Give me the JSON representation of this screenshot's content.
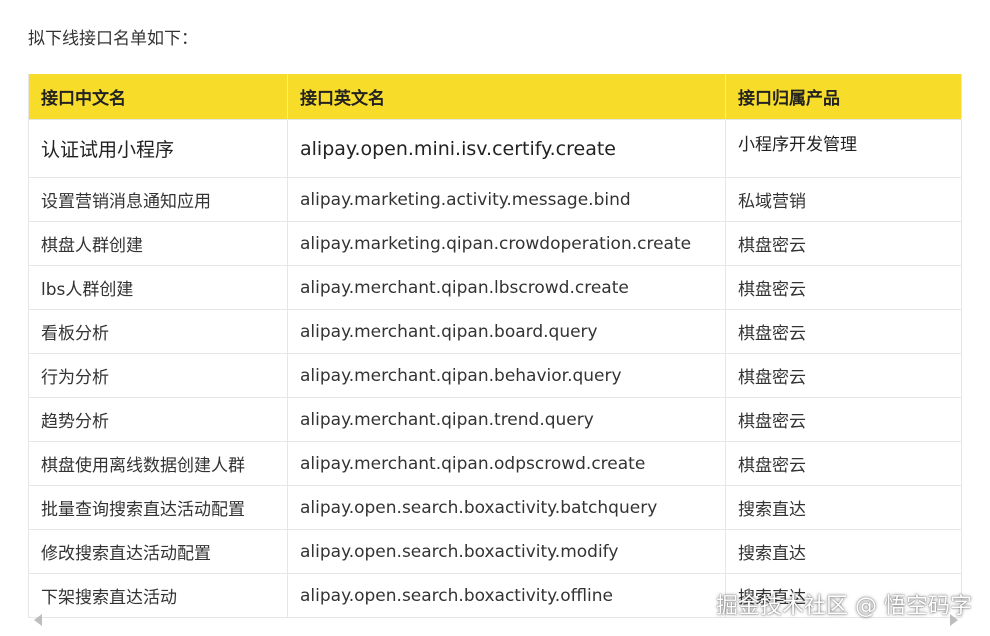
{
  "intro": "拟下线接口名单如下：",
  "table": {
    "headers": [
      "接口中文名",
      "接口英文名",
      "接口归属产品"
    ],
    "rows": [
      [
        "认证试用小程序",
        "alipay.open.mini.isv.certify.create",
        "小程序开发管理"
      ],
      [
        "设置营销消息通知应用",
        "alipay.marketing.activity.message.bind",
        "私域营销"
      ],
      [
        "棋盘人群创建",
        "alipay.marketing.qipan.crowdoperation.create",
        "棋盘密云"
      ],
      [
        "lbs人群创建",
        "alipay.merchant.qipan.lbscrowd.create",
        "棋盘密云"
      ],
      [
        "看板分析",
        "alipay.merchant.qipan.board.query",
        "棋盘密云"
      ],
      [
        "行为分析",
        "alipay.merchant.qipan.behavior.query",
        "棋盘密云"
      ],
      [
        "趋势分析",
        "alipay.merchant.qipan.trend.query",
        "棋盘密云"
      ],
      [
        "棋盘使用离线数据创建人群",
        "alipay.merchant.qipan.odpscrowd.create",
        "棋盘密云"
      ],
      [
        "批量查询搜索直达活动配置",
        "alipay.open.search.boxactivity.batchquery",
        "搜索直达"
      ],
      [
        "修改搜索直达活动配置",
        "alipay.open.search.boxactivity.modify",
        "搜索直达"
      ],
      [
        "下架搜索直达活动",
        "alipay.open.search.boxactivity.offline",
        "搜索直达"
      ]
    ]
  },
  "watermark": "掘金技术社区 @ 悟空码字",
  "colors": {
    "header_bg": "#f7dc2a",
    "border": "#e6e6e6"
  },
  "icons": {
    "scroll_left": "caret-left-icon",
    "scroll_right": "caret-right-icon"
  }
}
